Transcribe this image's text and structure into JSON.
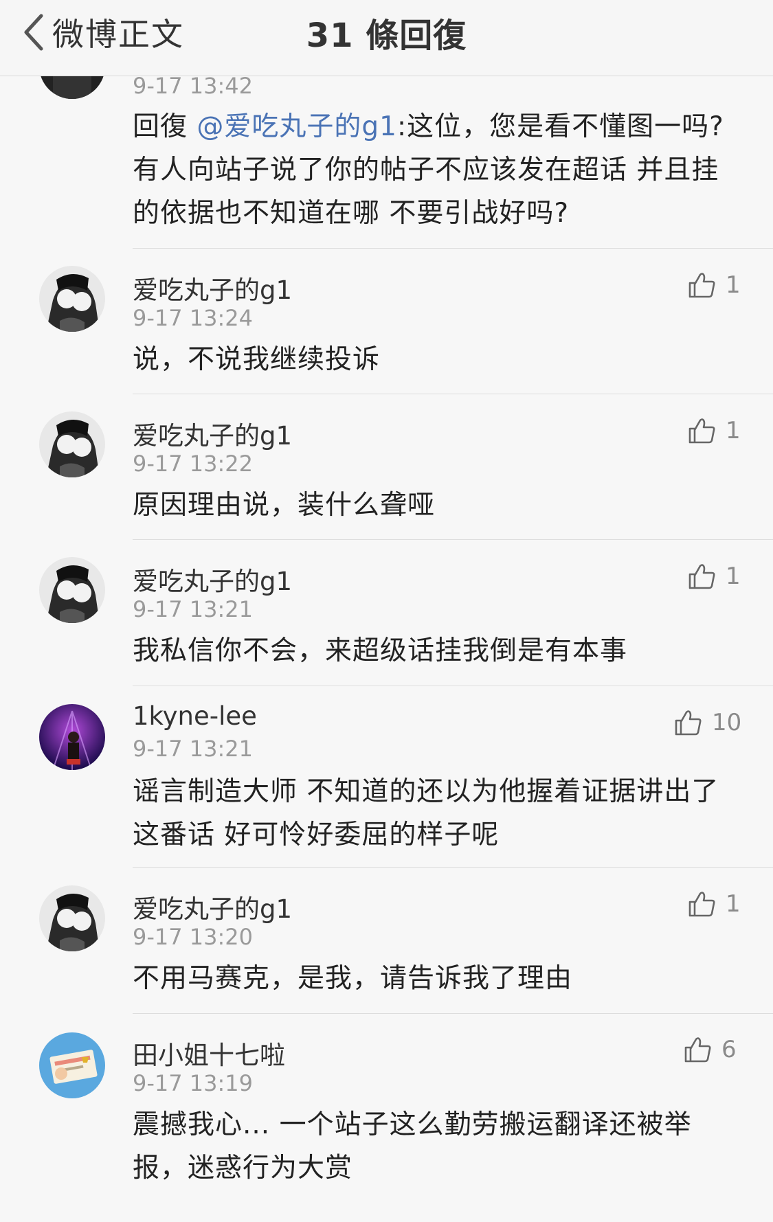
{
  "navbar": {
    "back_label": "微博正文",
    "title": "31 條回復"
  },
  "comments": [
    {
      "time": "9-17 13:42",
      "reply_prefix": "回復 ",
      "mention": "@爱吃丸子的g1",
      "text": ":这位，您是看不懂图一吗?有人向站子说了你的帖子不应该发在超话 并且挂的依据也不知道在哪 不要引战好吗?"
    },
    {
      "name": "爱吃丸子的g1",
      "time": "9-17 13:24",
      "likes": "1",
      "text": "说，不说我继续投诉"
    },
    {
      "name": "爱吃丸子的g1",
      "time": "9-17 13:22",
      "likes": "1",
      "text": "原因理由说，装什么聋哑"
    },
    {
      "name": "爱吃丸子的g1",
      "time": "9-17 13:21",
      "likes": "1",
      "text": "我私信你不会，来超级话挂我倒是有本事"
    },
    {
      "name": "1kyne-lee",
      "time": "9-17 13:21",
      "likes": "10",
      "text": "谣言制造大师 不知道的还以为他握着证据讲出了这番话 好可怜好委屈的样子呢"
    },
    {
      "name": "爱吃丸子的g1",
      "time": "9-17 13:20",
      "likes": "1",
      "text": "不用马赛克，是我，请告诉我了理由"
    },
    {
      "name": "田小姐十七啦",
      "time": "9-17 13:19",
      "likes": "6",
      "text": "震撼我心... 一个站子这么勤劳搬运翻译还被举报，迷惑行为大赏"
    }
  ],
  "icons": {
    "back": "chevron-left-icon",
    "like": "thumbs-up-icon"
  },
  "colors": {
    "mention": "#4a73b5",
    "timestamp": "#9a9a9a",
    "background": "#f7f7f7"
  }
}
